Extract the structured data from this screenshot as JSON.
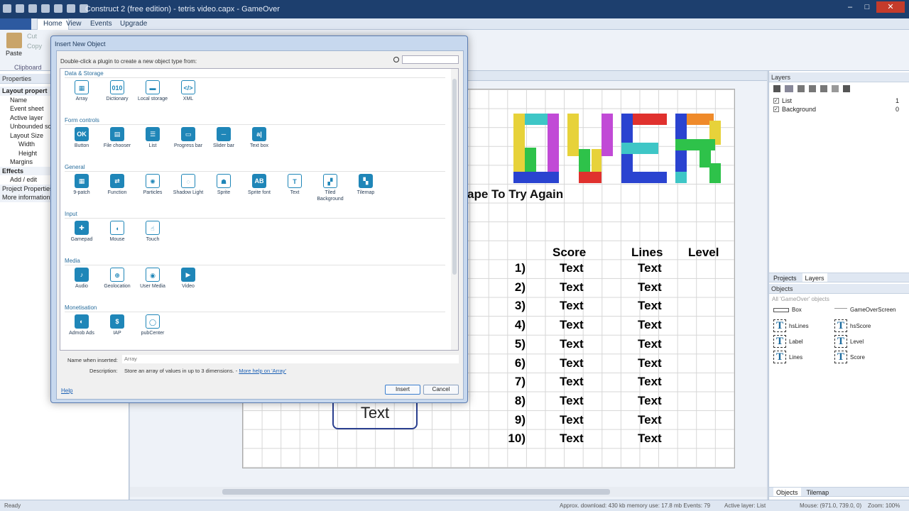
{
  "window": {
    "title": "Construct 2 (free edition) - tetris video.capx - GameOver"
  },
  "ribbon": {
    "tabs": [
      "Home",
      "View",
      "Events",
      "Upgrade"
    ],
    "paste_label": "Paste",
    "cut_label": "Cut",
    "copy_label": "Copy",
    "clipboard_label": "Clipboard"
  },
  "properties": {
    "header": "Properties",
    "rows": [
      {
        "text": "Layout propert",
        "kind": "cat"
      },
      {
        "text": "Name",
        "kind": "item"
      },
      {
        "text": "Event sheet",
        "kind": "item"
      },
      {
        "text": "Active layer",
        "kind": "item"
      },
      {
        "text": "Unbounded scr",
        "kind": "item"
      },
      {
        "text": "Layout Size",
        "kind": "item"
      },
      {
        "text": "Width",
        "kind": "sub"
      },
      {
        "text": "Height",
        "kind": "sub"
      },
      {
        "text": "Margins",
        "kind": "item"
      },
      {
        "text": "Effects",
        "kind": "cat"
      },
      {
        "text": "Add / edit",
        "kind": "item"
      },
      {
        "text": "Project Properties",
        "kind": "plain"
      },
      {
        "text": "More information",
        "kind": "plain"
      }
    ]
  },
  "layout_view": {
    "partial_title": "ape To Try Again",
    "headers": {
      "score": "Score",
      "lines": "Lines",
      "level": "Level"
    },
    "ranks": [
      "1)",
      "2)",
      "3)",
      "4)",
      "5)",
      "6)",
      "7)",
      "8)",
      "9)",
      "10)"
    ],
    "cell_text": "Text",
    "button_text": "Text"
  },
  "layers": {
    "header": "Layers",
    "items": [
      {
        "name": "List",
        "num": "1"
      },
      {
        "name": "Background",
        "num": "0"
      }
    ],
    "tabs": [
      "Projects",
      "Layers"
    ]
  },
  "objects": {
    "header": "Objects",
    "filter": "All 'GameOver' objects",
    "items": [
      "Box",
      "GameOverScreen",
      "hsLines",
      "hsScore",
      "Label",
      "Level",
      "Lines",
      "Score"
    ],
    "bottom_tabs": [
      "Objects",
      "Tilemap"
    ]
  },
  "status": {
    "ready": "Ready",
    "download": "Approx. download: 430 kb   memory use: 17.8 mb   Events: 79",
    "active_layer": "Active layer: List",
    "mouse": "Mouse: (971.0, 739.0, 0)",
    "zoom": "Zoom: 100%"
  },
  "dialog": {
    "title": "Insert New Object",
    "instruction": "Double-click a plugin to create a new object type from:",
    "categories": [
      {
        "name": "Data & Storage",
        "plugins": [
          "Array",
          "Dictionary",
          "Local storage",
          "XML"
        ]
      },
      {
        "name": "Form controls",
        "plugins": [
          "Button",
          "File chooser",
          "List",
          "Progress bar",
          "Slider bar",
          "Text box"
        ]
      },
      {
        "name": "General",
        "plugins": [
          "9-patch",
          "Function",
          "Particles",
          "Shadow Light",
          "Sprite",
          "Sprite font",
          "Text",
          "Tiled Background",
          "Tilemap"
        ]
      },
      {
        "name": "Input",
        "plugins": [
          "Gamepad",
          "Mouse",
          "Touch"
        ]
      },
      {
        "name": "Media",
        "plugins": [
          "Audio",
          "Geolocation",
          "User Media",
          "Video"
        ]
      },
      {
        "name": "Monetisation",
        "plugins": [
          "Admob Ads",
          "IAP",
          "pubCenter"
        ]
      }
    ],
    "name_label": "Name when inserted:",
    "name_value": "Array",
    "desc_label": "Description:",
    "desc_text": "Store an array of values in up to 3 dimensions. - ",
    "desc_link": "More help on 'Array'",
    "help": "Help",
    "insert": "Insert",
    "cancel": "Cancel"
  }
}
